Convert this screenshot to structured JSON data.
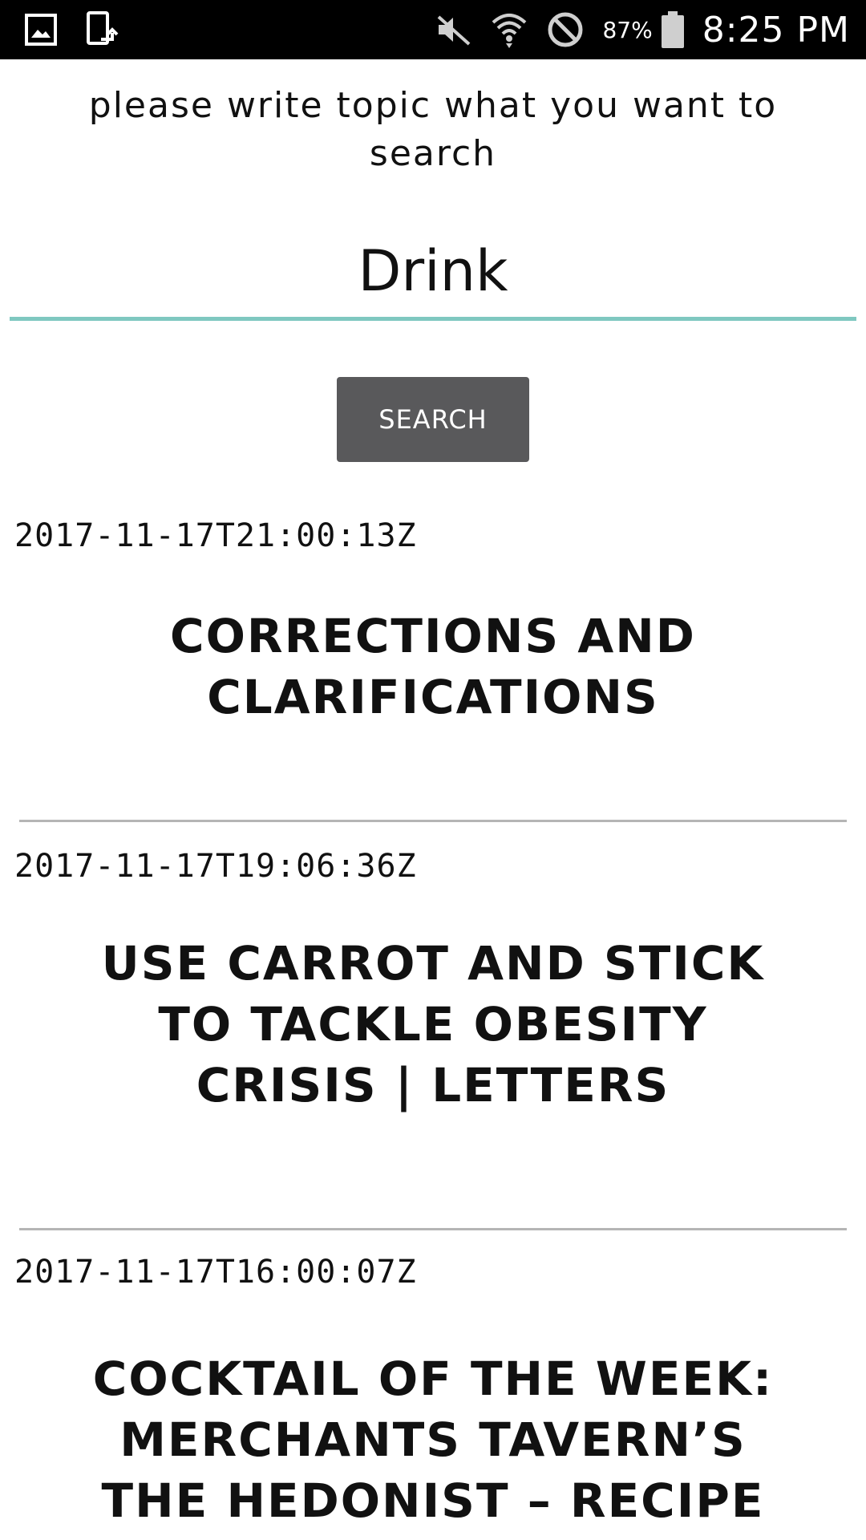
{
  "status_bar": {
    "icons_left": [
      "gallery-icon",
      "screen-rotate-icon"
    ],
    "icons_right": [
      "mute-icon",
      "wifi-icon",
      "do-not-disturb-icon",
      "battery-icon"
    ],
    "battery_percent": "87%",
    "time": "8:25 PM"
  },
  "prompt": {
    "text": "please write topic what you want to search"
  },
  "search": {
    "value": "Drink",
    "button_label": "SEARCH"
  },
  "results": [
    {
      "date": "2017-11-17T21:00:13Z",
      "title": "CORRECTIONS AND CLARIFICATIONS"
    },
    {
      "date": "2017-11-17T19:06:36Z",
      "title": "USE CARROT AND STICK TO TACKLE OBESITY CRISIS | LETTERS"
    },
    {
      "date": "2017-11-17T16:00:07Z",
      "title": "COCKTAIL OF THE WEEK: MERCHANTS TAVERN’S THE HEDONIST – RECIPE"
    }
  ],
  "colors": {
    "accent": "#7fc8c0",
    "button_bg": "#59595b",
    "status_bar_bg": "#000000",
    "divider": "#b5b5b5"
  }
}
